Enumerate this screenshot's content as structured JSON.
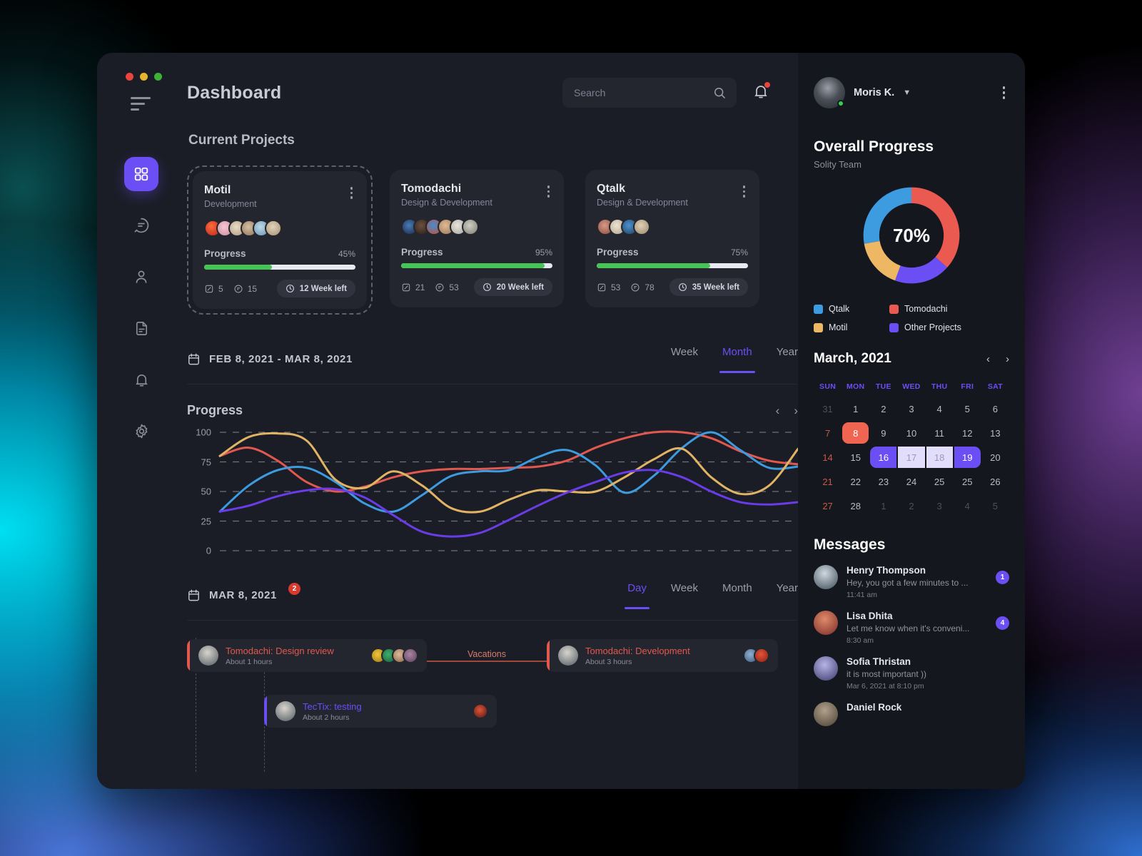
{
  "window": {
    "traffic_lights": [
      "close",
      "minimize",
      "maximize"
    ]
  },
  "sidebar": {
    "menu_icon": "hamburger-icon",
    "items": [
      {
        "name": "dashboard",
        "icon": "grid-icon",
        "active": true
      },
      {
        "name": "messages",
        "icon": "chat-bubble-icon",
        "active": false
      },
      {
        "name": "profile",
        "icon": "user-icon",
        "active": false
      },
      {
        "name": "documents",
        "icon": "document-icon",
        "active": false
      },
      {
        "name": "notifications",
        "icon": "bell-icon",
        "active": false
      },
      {
        "name": "settings",
        "icon": "gear-icon",
        "active": false
      }
    ]
  },
  "header": {
    "title": "Dashboard",
    "search": {
      "value": "",
      "placeholder": "Search",
      "icon": "search-icon"
    },
    "notification": {
      "icon": "bell-icon",
      "has_unread": true
    },
    "user": {
      "name": "Moris K.",
      "status": "online",
      "chevron": "chevron-down-icon"
    },
    "more_icon": "kebab-menu-icon"
  },
  "projects": {
    "section_title": "Current Projects",
    "cards": [
      {
        "name": "Motil",
        "subtitle": "Development",
        "selected": true,
        "progress_label": "Progress",
        "progress_pct": "45%",
        "progress_value": 45,
        "attachments": "5",
        "comments": "15",
        "time_left": "12 Week left",
        "avatars": [
          "#d6452f",
          "#f0c0cc",
          "#e6d7c6",
          "#c9b49a",
          "#9fc5dd",
          "#d8cfc0"
        ],
        "avatar_count": 6
      },
      {
        "name": "Tomodachi",
        "subtitle": "Design & Development",
        "selected": false,
        "progress_label": "Progress",
        "progress_pct": "95%",
        "progress_value": 95,
        "attachments": "21",
        "comments": "53",
        "time_left": "20 Week left",
        "avatars": [
          "#2a4a74",
          "#3a2b24",
          "#1f4f8a",
          "#c8a98c",
          "#cfcfc6",
          "#b9b9b0"
        ],
        "avatar_count": 6
      },
      {
        "name": "Qtalk",
        "subtitle": "Design & Development",
        "selected": false,
        "progress_label": "Progress",
        "progress_pct": "75%",
        "progress_value": 75,
        "attachments": "53",
        "comments": "78",
        "time_left": "35 Week left",
        "avatars": [
          "#b07060",
          "#d8cdbc",
          "#3d6f9c",
          "#cbb79c"
        ],
        "avatar_count": 4
      }
    ]
  },
  "range": {
    "calendar_icon": "calendar-icon",
    "text": "FEB 8, 2021 - MAR 8, 2021",
    "tabs": [
      {
        "label": "Week",
        "active": false
      },
      {
        "label": "Month",
        "active": true
      },
      {
        "label": "Year",
        "active": false
      }
    ]
  },
  "chart_data": {
    "type": "line",
    "title": "Progress",
    "xlabel": "",
    "ylabel": "",
    "ylim": [
      0,
      100
    ],
    "yticks": [
      100,
      75,
      50,
      25,
      0
    ],
    "grid": "horizontal-dashed",
    "legend": "none",
    "x": [
      0,
      1,
      2,
      3,
      4,
      5,
      6,
      7,
      8,
      9,
      10,
      11,
      12,
      13,
      14,
      15,
      16,
      17,
      18,
      19,
      20
    ],
    "series": [
      {
        "name": "Series Red",
        "color": "#e2584f",
        "values": [
          80,
          87,
          76,
          58,
          50,
          54,
          62,
          67,
          69,
          69,
          70,
          71,
          76,
          87,
          95,
          100,
          100,
          95,
          84,
          76,
          73
        ]
      },
      {
        "name": "Series Blue",
        "color": "#3d9be0",
        "values": [
          33,
          55,
          68,
          70,
          58,
          40,
          33,
          47,
          63,
          67,
          68,
          79,
          85,
          72,
          49,
          63,
          87,
          100,
          85,
          70,
          71
        ]
      },
      {
        "name": "Series Gold",
        "color": "#e0b464",
        "values": [
          80,
          96,
          99,
          93,
          60,
          53,
          67,
          55,
          36,
          33,
          43,
          51,
          50,
          50,
          62,
          77,
          86,
          62,
          48,
          55,
          86
        ]
      },
      {
        "name": "Series Violet",
        "color": "#6a3ce8",
        "values": [
          33,
          38,
          46,
          51,
          52,
          45,
          30,
          16,
          12,
          15,
          26,
          38,
          49,
          58,
          66,
          68,
          62,
          50,
          41,
          39,
          41
        ]
      }
    ]
  },
  "timeline_header": {
    "calendar_icon": "calendar-icon",
    "date": "MAR 8, 2021",
    "badge": "2",
    "tabs": [
      {
        "label": "Day",
        "active": true
      },
      {
        "label": "Week",
        "active": false
      },
      {
        "label": "Month",
        "active": false
      },
      {
        "label": "Year",
        "active": false
      }
    ]
  },
  "timeline": {
    "events": [
      {
        "title": "Tomodachi: Design review",
        "duration": "About 1 hours",
        "accent": "#e2584f",
        "title_color": "#e2584f",
        "avatars": [
          "#e0b03a",
          "#2e8b57",
          "#c79f7a",
          "#8f6a86"
        ],
        "avatar_count": 4
      },
      {
        "title": "Tomodachi: Development",
        "duration": "About 3 hours",
        "accent": "#e2584f",
        "title_color": "#e2584f",
        "avatars": [
          "#6b93c4",
          "#c2402f"
        ],
        "avatar_count": 2
      },
      {
        "title": "TecTix: testing",
        "duration": "About 2 hours",
        "accent": "#6c4ef5",
        "title_color": "#6c4ef5",
        "avatars": [
          "#b63a2a"
        ],
        "avatar_count": 1
      }
    ],
    "vacation_label": "Vacations",
    "vacation_color": "#d97b6c"
  },
  "overall_progress": {
    "title": "Overall Progress",
    "subtitle": "Solity Team",
    "center_value": "70%",
    "donut": {
      "type": "pie",
      "segments": [
        {
          "label": "Tomodachi",
          "color": "#ea5a50",
          "percent": 33
        },
        {
          "label": "Other Projects",
          "color": "#6c4ef5",
          "percent": 17
        },
        {
          "label": "Motil",
          "color": "#edb764",
          "percent": 15
        },
        {
          "label": "Qtalk",
          "color": "#3d9be0",
          "percent": 25
        }
      ]
    },
    "legend": [
      {
        "label": "Qtalk",
        "color": "#3d9be0"
      },
      {
        "label": "Tomodachi",
        "color": "#ea5a50"
      },
      {
        "label": "Motil",
        "color": "#edb764"
      },
      {
        "label": "Other Projects",
        "color": "#6c4ef5"
      }
    ]
  },
  "calendar": {
    "title": "March, 2021",
    "prev_icon": "chevron-left-icon",
    "next_icon": "chevron-right-icon",
    "dow": [
      "SUN",
      "MON",
      "TUE",
      "WED",
      "THU",
      "FRI",
      "SAT"
    ],
    "weeks": [
      [
        {
          "d": "31",
          "state": "muted"
        },
        {
          "d": "1",
          "state": ""
        },
        {
          "d": "2",
          "state": ""
        },
        {
          "d": "3",
          "state": ""
        },
        {
          "d": "4",
          "state": ""
        },
        {
          "d": "5",
          "state": ""
        },
        {
          "d": "6",
          "state": ""
        }
      ],
      [
        {
          "d": "7",
          "state": "sun"
        },
        {
          "d": "8",
          "state": "today"
        },
        {
          "d": "9",
          "state": ""
        },
        {
          "d": "10",
          "state": ""
        },
        {
          "d": "11",
          "state": ""
        },
        {
          "d": "12",
          "state": ""
        },
        {
          "d": "13",
          "state": ""
        }
      ],
      [
        {
          "d": "14",
          "state": "sun"
        },
        {
          "d": "15",
          "state": ""
        },
        {
          "d": "16",
          "state": "r-start"
        },
        {
          "d": "17",
          "state": "r-mid"
        },
        {
          "d": "18",
          "state": "r-mid"
        },
        {
          "d": "19",
          "state": "r-end"
        },
        {
          "d": "20",
          "state": ""
        }
      ],
      [
        {
          "d": "21",
          "state": "sun"
        },
        {
          "d": "22",
          "state": ""
        },
        {
          "d": "23",
          "state": ""
        },
        {
          "d": "24",
          "state": ""
        },
        {
          "d": "25",
          "state": ""
        },
        {
          "d": "25",
          "state": ""
        },
        {
          "d": "26",
          "state": ""
        }
      ],
      [
        {
          "d": "27",
          "state": "sun"
        },
        {
          "d": "28",
          "state": ""
        },
        {
          "d": "1",
          "state": "muted"
        },
        {
          "d": "2",
          "state": "muted"
        },
        {
          "d": "3",
          "state": "muted"
        },
        {
          "d": "4",
          "state": "muted"
        },
        {
          "d": "5",
          "state": "muted"
        }
      ]
    ]
  },
  "messages": {
    "title": "Messages",
    "items": [
      {
        "name": "Henry Thompson",
        "preview": "Hey, you got a few minutes to ...",
        "time": "11:41 am",
        "badge": "1",
        "avatar": "#9fb6c4"
      },
      {
        "name": "Lisa Dhita",
        "preview": "Let me know when it's conveni...",
        "time": "8:30 am",
        "badge": "4",
        "avatar": "#a8564a"
      },
      {
        "name": "Sofia Thristan",
        "preview": "it is most important ))",
        "time": "Mar 6, 2021 at 8:10 pm",
        "badge": "",
        "avatar": "#8d8fd0"
      },
      {
        "name": "Daniel Rock",
        "preview": "",
        "time": "",
        "badge": "",
        "avatar": "#6a5b4e"
      }
    ]
  }
}
